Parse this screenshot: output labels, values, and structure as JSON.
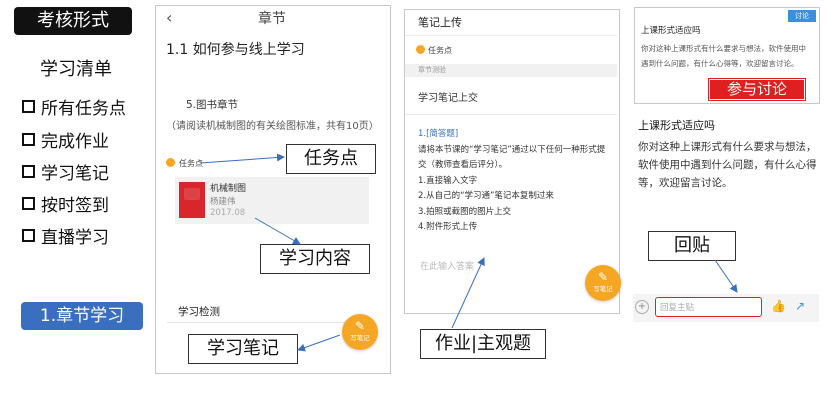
{
  "left": {
    "badge": "考核形式",
    "menu_title": "学习清单",
    "items": [
      "所有任务点",
      "完成作业",
      "学习笔记",
      "按时签到",
      "直播学习"
    ],
    "chapter_badge": "1.章节学习"
  },
  "phone1": {
    "back": "‹",
    "title": "章节",
    "heading": "1.1 如何参与线上学习",
    "section": "5.图书章节",
    "description": "（请阅读机械制图的有关绘图标准，共有10页）",
    "task_label": "任务点",
    "book": {
      "name": "机械制图",
      "author": "杨建伟",
      "year": "2017.08"
    },
    "check_title": "学习检测",
    "fab_label": "写笔记"
  },
  "callouts": {
    "task_point": "任务点",
    "learning_content": "学习内容",
    "notes": "学习笔记",
    "homework": "作业|主观题",
    "reply": "回贴"
  },
  "phone2": {
    "title": "笔记上传",
    "task_label": "任务点",
    "section_label": "章节测验",
    "submit_label": "学习笔记上交",
    "question_tag": "1.[简答题]",
    "question_text": "请将本节课的“学习笔记”通过以下任何一种形式提交（教师查看后评分）。",
    "options": [
      "1.直接输入文字",
      "2.从自己的“学习通”笔记本复制过来",
      "3.拍照或截图的图片上交",
      "4.附件形式上传"
    ],
    "placeholder": "在此输入答案",
    "fab_label": "写笔记"
  },
  "discussion_card": {
    "tag": "讨论",
    "title": "上课形式适应吗",
    "body": "你对这种上课形式有什么要求与想法，软件使用中遇到什么问题，有什么心得等，欢迎留言讨论。",
    "button": "参与讨论"
  },
  "discussion_detail": {
    "title": "上课形式适应吗",
    "body": "你对这种上课形式有什么要求与想法，软件使用中遇到什么问题，有什么心得等，欢迎留言讨论。",
    "reply_placeholder": "回复主贴",
    "plus": "+",
    "like_icon": "👍",
    "share_icon": "↗"
  },
  "colors": {
    "accent_orange": "#f5a623",
    "accent_blue": "#3a6fbf",
    "accent_red": "#e02020"
  }
}
